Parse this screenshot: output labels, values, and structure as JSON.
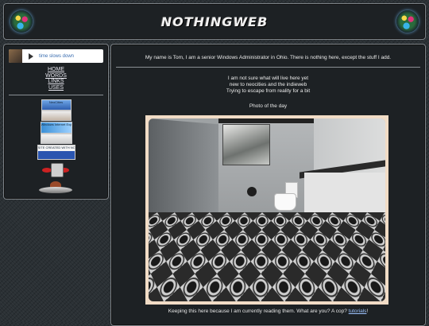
{
  "header": {
    "title": "NOTHINGWEB",
    "left_icon": "globe-icon",
    "right_icon": "globe-icon"
  },
  "sidebar": {
    "player": {
      "song": "time slows down",
      "icon": "play-icon"
    },
    "nav": [
      "HOME",
      "WORDS",
      "LINKS",
      "USES"
    ],
    "badges": [
      {
        "name": "neocities-badge",
        "text": "NeoCities"
      },
      {
        "name": "mozilla-badge",
        "text": ""
      },
      {
        "name": "windows-badge",
        "text": "Windows Internet Explorer 7"
      },
      {
        "name": "no-cookies-badge",
        "text": ""
      },
      {
        "name": "notepad-badge",
        "text": "SITE CREATED WITH NOTEPAD"
      }
    ]
  },
  "main": {
    "intro": "My name is Tom, I am a senior Windows Administrator in Ohio. There is nothing here, except the stuff I add.",
    "lines": [
      "I am not sure what will live here yet",
      "new to neocities and the indieweb",
      "Trying to escape from reality for a bit"
    ],
    "photo_label": "Photo of the day",
    "caption_text": "Keeping this here because I am currently reading them. What are you? A cop?",
    "caption_link": "tutorials",
    "caption_end": "!"
  }
}
